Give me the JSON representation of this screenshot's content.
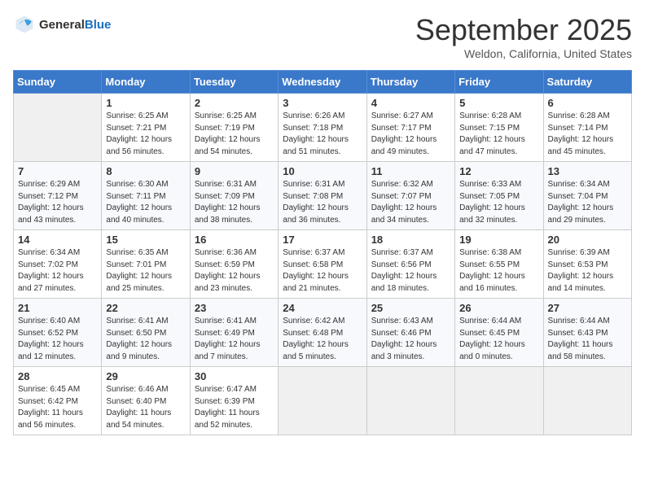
{
  "header": {
    "logo_general": "General",
    "logo_blue": "Blue",
    "month_title": "September 2025",
    "location": "Weldon, California, United States"
  },
  "weekdays": [
    "Sunday",
    "Monday",
    "Tuesday",
    "Wednesday",
    "Thursday",
    "Friday",
    "Saturday"
  ],
  "weeks": [
    [
      {
        "day": "",
        "sunrise": "",
        "sunset": "",
        "daylight": ""
      },
      {
        "day": "1",
        "sunrise": "Sunrise: 6:25 AM",
        "sunset": "Sunset: 7:21 PM",
        "daylight": "Daylight: 12 hours and 56 minutes."
      },
      {
        "day": "2",
        "sunrise": "Sunrise: 6:25 AM",
        "sunset": "Sunset: 7:19 PM",
        "daylight": "Daylight: 12 hours and 54 minutes."
      },
      {
        "day": "3",
        "sunrise": "Sunrise: 6:26 AM",
        "sunset": "Sunset: 7:18 PM",
        "daylight": "Daylight: 12 hours and 51 minutes."
      },
      {
        "day": "4",
        "sunrise": "Sunrise: 6:27 AM",
        "sunset": "Sunset: 7:17 PM",
        "daylight": "Daylight: 12 hours and 49 minutes."
      },
      {
        "day": "5",
        "sunrise": "Sunrise: 6:28 AM",
        "sunset": "Sunset: 7:15 PM",
        "daylight": "Daylight: 12 hours and 47 minutes."
      },
      {
        "day": "6",
        "sunrise": "Sunrise: 6:28 AM",
        "sunset": "Sunset: 7:14 PM",
        "daylight": "Daylight: 12 hours and 45 minutes."
      }
    ],
    [
      {
        "day": "7",
        "sunrise": "Sunrise: 6:29 AM",
        "sunset": "Sunset: 7:12 PM",
        "daylight": "Daylight: 12 hours and 43 minutes."
      },
      {
        "day": "8",
        "sunrise": "Sunrise: 6:30 AM",
        "sunset": "Sunset: 7:11 PM",
        "daylight": "Daylight: 12 hours and 40 minutes."
      },
      {
        "day": "9",
        "sunrise": "Sunrise: 6:31 AM",
        "sunset": "Sunset: 7:09 PM",
        "daylight": "Daylight: 12 hours and 38 minutes."
      },
      {
        "day": "10",
        "sunrise": "Sunrise: 6:31 AM",
        "sunset": "Sunset: 7:08 PM",
        "daylight": "Daylight: 12 hours and 36 minutes."
      },
      {
        "day": "11",
        "sunrise": "Sunrise: 6:32 AM",
        "sunset": "Sunset: 7:07 PM",
        "daylight": "Daylight: 12 hours and 34 minutes."
      },
      {
        "day": "12",
        "sunrise": "Sunrise: 6:33 AM",
        "sunset": "Sunset: 7:05 PM",
        "daylight": "Daylight: 12 hours and 32 minutes."
      },
      {
        "day": "13",
        "sunrise": "Sunrise: 6:34 AM",
        "sunset": "Sunset: 7:04 PM",
        "daylight": "Daylight: 12 hours and 29 minutes."
      }
    ],
    [
      {
        "day": "14",
        "sunrise": "Sunrise: 6:34 AM",
        "sunset": "Sunset: 7:02 PM",
        "daylight": "Daylight: 12 hours and 27 minutes."
      },
      {
        "day": "15",
        "sunrise": "Sunrise: 6:35 AM",
        "sunset": "Sunset: 7:01 PM",
        "daylight": "Daylight: 12 hours and 25 minutes."
      },
      {
        "day": "16",
        "sunrise": "Sunrise: 6:36 AM",
        "sunset": "Sunset: 6:59 PM",
        "daylight": "Daylight: 12 hours and 23 minutes."
      },
      {
        "day": "17",
        "sunrise": "Sunrise: 6:37 AM",
        "sunset": "Sunset: 6:58 PM",
        "daylight": "Daylight: 12 hours and 21 minutes."
      },
      {
        "day": "18",
        "sunrise": "Sunrise: 6:37 AM",
        "sunset": "Sunset: 6:56 PM",
        "daylight": "Daylight: 12 hours and 18 minutes."
      },
      {
        "day": "19",
        "sunrise": "Sunrise: 6:38 AM",
        "sunset": "Sunset: 6:55 PM",
        "daylight": "Daylight: 12 hours and 16 minutes."
      },
      {
        "day": "20",
        "sunrise": "Sunrise: 6:39 AM",
        "sunset": "Sunset: 6:53 PM",
        "daylight": "Daylight: 12 hours and 14 minutes."
      }
    ],
    [
      {
        "day": "21",
        "sunrise": "Sunrise: 6:40 AM",
        "sunset": "Sunset: 6:52 PM",
        "daylight": "Daylight: 12 hours and 12 minutes."
      },
      {
        "day": "22",
        "sunrise": "Sunrise: 6:41 AM",
        "sunset": "Sunset: 6:50 PM",
        "daylight": "Daylight: 12 hours and 9 minutes."
      },
      {
        "day": "23",
        "sunrise": "Sunrise: 6:41 AM",
        "sunset": "Sunset: 6:49 PM",
        "daylight": "Daylight: 12 hours and 7 minutes."
      },
      {
        "day": "24",
        "sunrise": "Sunrise: 6:42 AM",
        "sunset": "Sunset: 6:48 PM",
        "daylight": "Daylight: 12 hours and 5 minutes."
      },
      {
        "day": "25",
        "sunrise": "Sunrise: 6:43 AM",
        "sunset": "Sunset: 6:46 PM",
        "daylight": "Daylight: 12 hours and 3 minutes."
      },
      {
        "day": "26",
        "sunrise": "Sunrise: 6:44 AM",
        "sunset": "Sunset: 6:45 PM",
        "daylight": "Daylight: 12 hours and 0 minutes."
      },
      {
        "day": "27",
        "sunrise": "Sunrise: 6:44 AM",
        "sunset": "Sunset: 6:43 PM",
        "daylight": "Daylight: 11 hours and 58 minutes."
      }
    ],
    [
      {
        "day": "28",
        "sunrise": "Sunrise: 6:45 AM",
        "sunset": "Sunset: 6:42 PM",
        "daylight": "Daylight: 11 hours and 56 minutes."
      },
      {
        "day": "29",
        "sunrise": "Sunrise: 6:46 AM",
        "sunset": "Sunset: 6:40 PM",
        "daylight": "Daylight: 11 hours and 54 minutes."
      },
      {
        "day": "30",
        "sunrise": "Sunrise: 6:47 AM",
        "sunset": "Sunset: 6:39 PM",
        "daylight": "Daylight: 11 hours and 52 minutes."
      },
      {
        "day": "",
        "sunrise": "",
        "sunset": "",
        "daylight": ""
      },
      {
        "day": "",
        "sunrise": "",
        "sunset": "",
        "daylight": ""
      },
      {
        "day": "",
        "sunrise": "",
        "sunset": "",
        "daylight": ""
      },
      {
        "day": "",
        "sunrise": "",
        "sunset": "",
        "daylight": ""
      }
    ]
  ]
}
